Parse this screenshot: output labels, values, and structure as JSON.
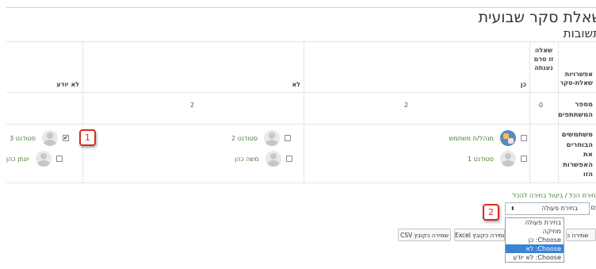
{
  "page": {
    "title": "שאלת סקר שבועית",
    "subtitle": "תשובות"
  },
  "table": {
    "headers": {
      "options": "אפשרויות שאלת-סקר",
      "not_answered": "שאלה זו טרם נענתה",
      "yes": "כן",
      "no": "לא",
      "dont_know": "לא יודע"
    },
    "count_row": {
      "label": "מספר המשתתפים",
      "not_answered": "0",
      "yes": "2",
      "no": "2",
      "dont_know": ""
    },
    "users_row": {
      "label": "משתמשים הבוחרים את האפשרות הזו",
      "yes": [
        {
          "name": "מנהל/ת משתמש",
          "avatar": "puzzle",
          "checked": false
        },
        {
          "name": "סטודנט 1",
          "avatar": "default",
          "checked": false
        }
      ],
      "no": [
        {
          "name": "סטודנט 2",
          "avatar": "default",
          "checked": false
        },
        {
          "name": "משה כהן",
          "avatar": "default",
          "checked": false
        }
      ],
      "dont_know": [
        {
          "name": "סטודנט 3",
          "avatar": "default",
          "checked": true
        },
        {
          "name": "יונתן כהן",
          "avatar": "default",
          "checked": false
        }
      ]
    }
  },
  "callouts": {
    "one": "1",
    "two": "2"
  },
  "actions": {
    "select_all": "בחירת הכל",
    "separator": "/",
    "deselect_all": "ביטול בחירה להכל",
    "with_selected": "עם נבחרים",
    "select_value": "בחירת פעולה",
    "options": [
      "בחירת פעולה",
      "מחיקה",
      "Choose: כן",
      "Choose: לא",
      "Choose: לא יודע"
    ],
    "selected_option_index": 3
  },
  "buttons": {
    "download_csv": "שמירה כקובץ CSV",
    "download_excel": "שמירה כקובץ Excel",
    "download_ods": "שמירה כ"
  },
  "colors": {
    "link_green": "#3d7a2c",
    "callout_red": "#d62d20",
    "selection_blue": "#3a84d6"
  }
}
